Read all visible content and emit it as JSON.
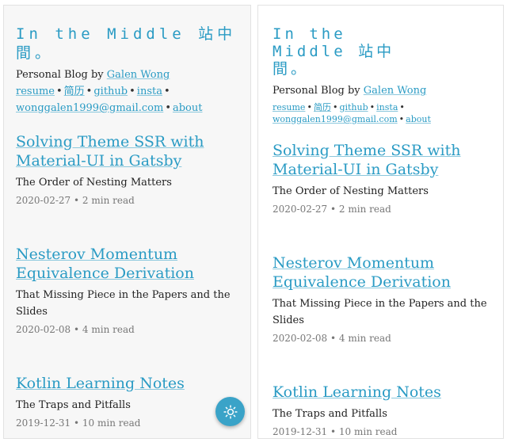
{
  "site": {
    "title": "In the Middle 站中間。",
    "bio_prefix": "Personal Blog by ",
    "author": "Galen Wong",
    "links": [
      "resume",
      "简历",
      "github",
      "insta",
      "wonggalen1999@gmail.com",
      "about"
    ],
    "separator": "•"
  },
  "posts": [
    {
      "title": "Solving Theme SSR with Material-UI in Gatsby",
      "subtitle": "The Order of Nesting Matters",
      "date": "2020-02-27",
      "read_time": "2 min read"
    },
    {
      "title": "Nesterov Momentum Equivalence Derivation",
      "subtitle": "That Missing Piece in the Papers and the Slides",
      "date": "2020-02-08",
      "read_time": "4 min read"
    },
    {
      "title": "Kotlin Learning Notes",
      "subtitle": "The Traps and Pitfalls",
      "date": "2019-12-31",
      "read_time": "10 min read"
    }
  ],
  "theme_toggle": {
    "icon": "sun-icon",
    "color": "#3aa3c8"
  },
  "colors": {
    "accent": "#2a9bc4",
    "meta": "#777777"
  }
}
